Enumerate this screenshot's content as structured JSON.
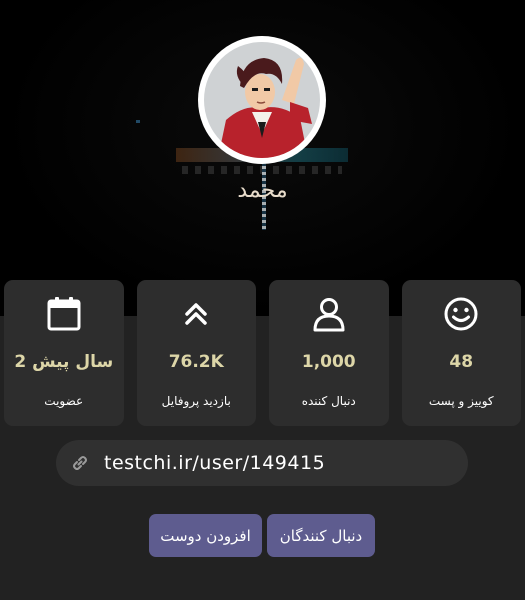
{
  "profile": {
    "name": "محمد",
    "avatar_icon": "avatar-image"
  },
  "stats": [
    {
      "icon": "smiley-icon",
      "value": "48",
      "label": "کوییز و پست"
    },
    {
      "icon": "user-icon",
      "value": "1,000",
      "label": "دنبال کننده"
    },
    {
      "icon": "chevrons-up-icon",
      "value": "76.2K",
      "label": "بازدید پروفایل"
    },
    {
      "icon": "calendar-icon",
      "value": "2 سال پیش",
      "label": "عضویت"
    }
  ],
  "profile_link": {
    "icon": "link-icon",
    "text": "testchi.ir/user/149415"
  },
  "actions": {
    "add_friend": "افزودن دوست",
    "followers": "دنبال کنندگان"
  },
  "colors": {
    "background": "#222222",
    "card": "#2d2d2d",
    "accent_text": "#ddd6a8",
    "button": "#5e5c8f"
  }
}
